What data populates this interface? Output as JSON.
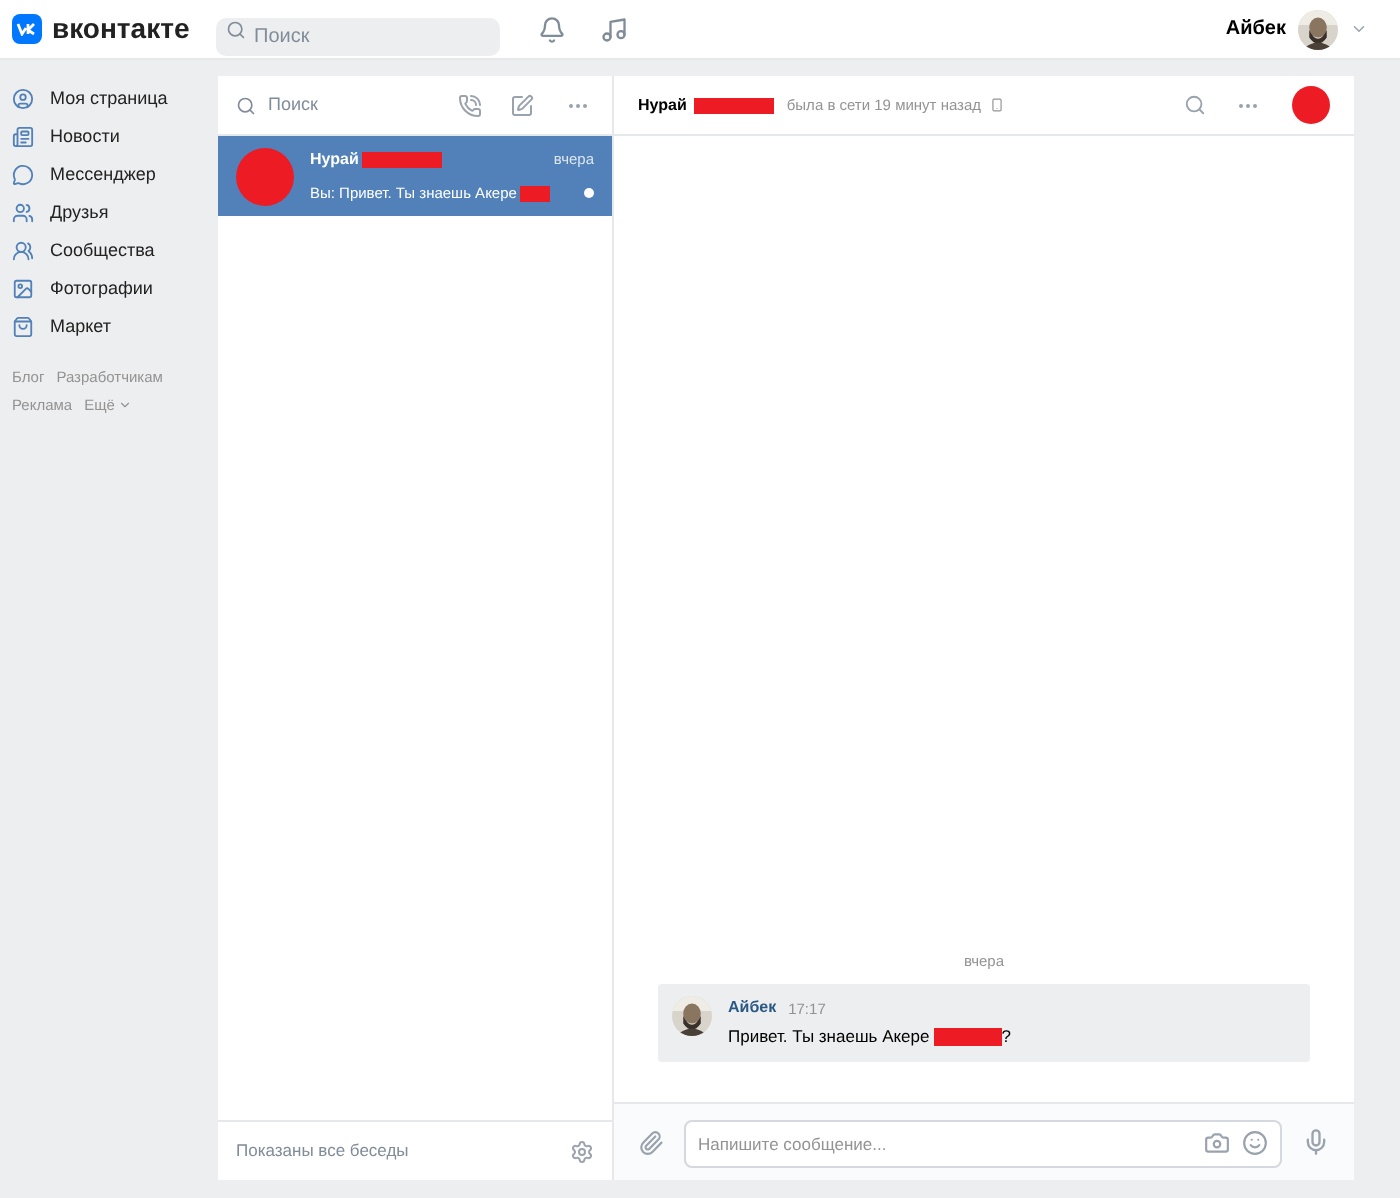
{
  "header": {
    "logo": "вконтакте",
    "search": {
      "placeholder": "Поиск"
    },
    "user": {
      "name": "Айбек"
    }
  },
  "sidebar": {
    "items": [
      {
        "label": "Моя страница"
      },
      {
        "label": "Новости"
      },
      {
        "label": "Мессенджер"
      },
      {
        "label": "Друзья"
      },
      {
        "label": "Сообщества"
      },
      {
        "label": "Фотографии"
      },
      {
        "label": "Маркет"
      }
    ],
    "footer_links": [
      {
        "label": "Блог"
      },
      {
        "label": "Разработчикам"
      },
      {
        "label": "Реклама"
      },
      {
        "label": "Ещё",
        "kind": "dropdown"
      }
    ]
  },
  "conversations": {
    "search": {
      "placeholder": "Поиск"
    },
    "items": [
      {
        "name": "Нурай",
        "time": "вчера",
        "preview": "Вы: Привет. Ты знаешь Акере",
        "selected": true,
        "unread": true
      }
    ],
    "footer": "Показаны все беседы"
  },
  "chat": {
    "name": "Нурай",
    "status": "была в сети 19 минут назад",
    "date": "вчера",
    "messages": [
      {
        "author": "Айбек",
        "time": "17:17",
        "text": "Привет. Ты знаешь Акере",
        "suffix": "?"
      }
    ],
    "composer": {
      "placeholder": "Напишите сообщение..."
    }
  }
}
